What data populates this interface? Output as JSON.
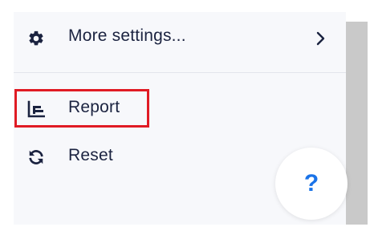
{
  "menu": {
    "items": [
      {
        "label": "More settings...",
        "icon": "gear-icon",
        "trailing_icon": "chevron-right-icon"
      },
      {
        "label": "Report",
        "icon": "bar-chart-icon"
      },
      {
        "label": "Reset",
        "icon": "refresh-icon"
      }
    ]
  },
  "help_button": {
    "label": "?"
  },
  "colors": {
    "text": "#1b2340",
    "panel_bg": "#f7f8fb",
    "highlight": "#e01b24",
    "help_accent": "#1a73e8"
  }
}
